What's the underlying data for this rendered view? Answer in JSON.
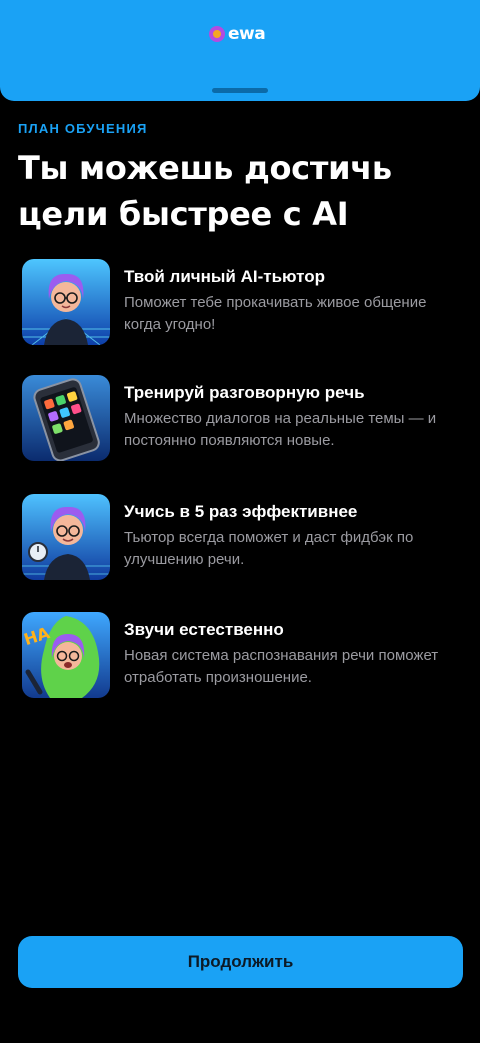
{
  "app": {
    "logo_text": "ewa"
  },
  "plan": {
    "eyebrow": "ПЛАН ОБУЧЕНИЯ",
    "headline": "Ты можешь достичь цели быстрее с AI"
  },
  "features": [
    {
      "title": "Твой личный AI-тьютор",
      "description": "Поможет тебе прокачивать живое общение когда угодно!",
      "icon": "ai-tutor-illustration"
    },
    {
      "title": "Тренируй разговорную речь",
      "description": "Множество диалогов на реальные темы — и постоянно появляются новые.",
      "icon": "phone-apps-illustration"
    },
    {
      "title": "Учись в 5 раз эффективнее",
      "description": "Тьютор всегда поможет и даст фидбэк по улучшению речи.",
      "icon": "tutor-stopwatch-illustration"
    },
    {
      "title": "Звучи естественно",
      "description": "Новая система распознавания речи поможет отработать произношение.",
      "icon": "speaking-illustration"
    }
  ],
  "cta": {
    "label": "Продолжить"
  },
  "colors": {
    "accent": "#1aa2f5",
    "background": "#000000",
    "muted_text": "#9b9ba1"
  }
}
